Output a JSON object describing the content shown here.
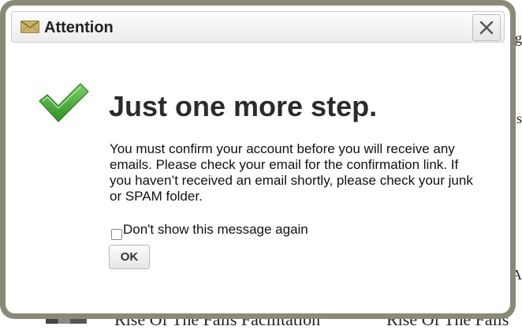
{
  "background": {
    "bottom_texts": [
      "Rise Of The Falls Facilitation",
      "Rise Of The Falls"
    ],
    "right_edge_glyphs": [
      "g",
      "s",
      "A"
    ]
  },
  "dialog": {
    "title": "Attention",
    "title_icon": "envelope-icon",
    "close_icon": "close-x-icon",
    "status_icon": "green-checkmark-icon",
    "heading": "Just one more step.",
    "message": "You must confirm your account before you will receive any emails. Please check your email for the confirmation link. If you haven’t received an email shortly, please check your junk or SPAM folder.",
    "dont_show_label": "Don't show this message again",
    "dont_show_checked": false,
    "ok_label": "OK"
  },
  "colors": {
    "frame": "#8b8a78",
    "check_green": "#4caf3a",
    "title_text": "#222222"
  }
}
